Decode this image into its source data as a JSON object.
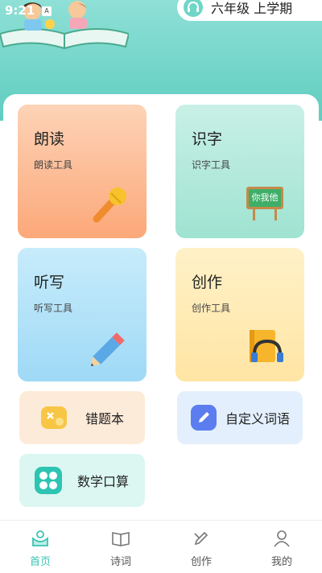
{
  "status": {
    "time": "9:21",
    "indicator": "A"
  },
  "header": {
    "grade": "六年级 上学期",
    "grade_icon": "headphones-icon"
  },
  "cards": [
    {
      "title": "朗读",
      "subtitle": "朗读工具",
      "icon": "microphone-icon"
    },
    {
      "title": "识字",
      "subtitle": "识字工具",
      "icon": "blackboard-icon",
      "board_text": "你我他"
    },
    {
      "title": "听写",
      "subtitle": "听写工具",
      "icon": "pencil-icon"
    },
    {
      "title": "创作",
      "subtitle": "创作工具",
      "icon": "book-headphones-icon"
    }
  ],
  "tools": [
    {
      "label": "错题本",
      "icon": "error-book-icon"
    },
    {
      "label": "自定义词语",
      "icon": "edit-icon"
    },
    {
      "label": "数学口算",
      "icon": "calculator-icon"
    }
  ],
  "tabs": [
    {
      "label": "首页",
      "icon": "home-icon",
      "active": true
    },
    {
      "label": "诗词",
      "icon": "poem-book-icon",
      "active": false
    },
    {
      "label": "创作",
      "icon": "create-icon",
      "active": false
    },
    {
      "label": "我的",
      "icon": "profile-icon",
      "active": false
    }
  ],
  "colors": {
    "accent": "#3ac3b3",
    "header": "#6fd6c8"
  }
}
